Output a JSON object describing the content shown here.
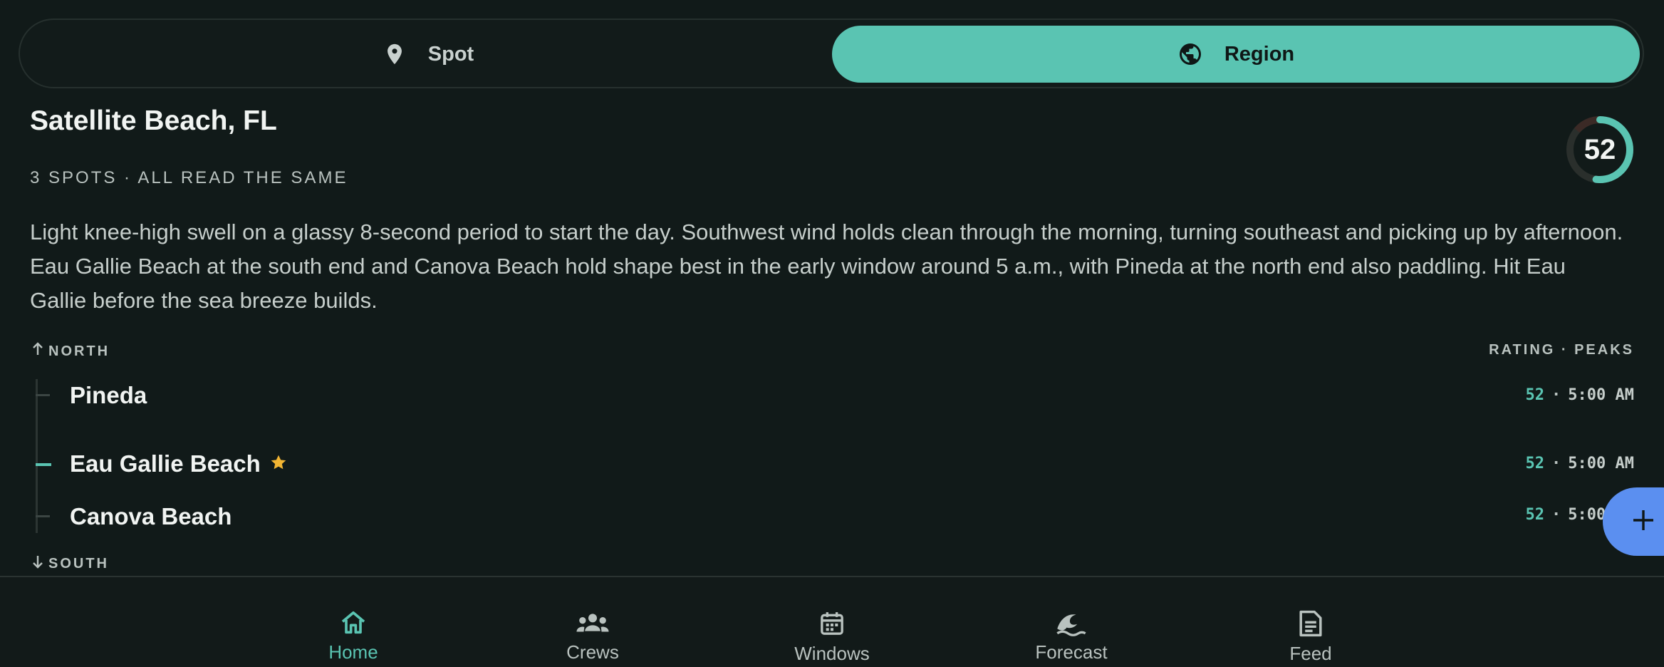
{
  "tabs": {
    "spot_label": "Spot",
    "region_label": "Region",
    "active": "region"
  },
  "region": {
    "title": "Satellite Beach, FL",
    "subtitle": "3 SPOTS · ALL READ THE SAME",
    "score": "52",
    "score_fraction": 0.52,
    "summary": "Light knee-high swell on a glassy 8-second period to start the day. Southwest wind holds clean through the morning, turning southeast and picking up by afternoon. Eau Gallie Beach at the south end and Canova Beach hold shape best in the early window around 5 a.m., with Pineda at the north end also paddling. Hit Eau Gallie before the sea breeze builds."
  },
  "list": {
    "north_label": "NORTH",
    "south_label": "SOUTH",
    "column_header": "RATING · PEAKS",
    "separator": "·",
    "spots": [
      {
        "name": "Pineda",
        "rating": "52",
        "peak": "5:00 AM",
        "favorite": false
      },
      {
        "name": "Eau Gallie Beach",
        "rating": "52",
        "peak": "5:00 AM",
        "favorite": true
      },
      {
        "name": "Canova Beach",
        "rating": "52",
        "peak": "5:00 AM",
        "favorite": false
      }
    ]
  },
  "nav": {
    "items": [
      {
        "label": "Home",
        "icon": "home-icon",
        "active": true
      },
      {
        "label": "Crews",
        "icon": "crews-icon",
        "active": false
      },
      {
        "label": "Windows",
        "icon": "calendar-icon",
        "active": false
      },
      {
        "label": "Forecast",
        "icon": "wave-icon",
        "active": false
      },
      {
        "label": "Feed",
        "icon": "feed-icon",
        "active": false
      }
    ]
  },
  "colors": {
    "background": "#111a19",
    "accent": "#5ac4b2",
    "fab": "#5b8ff0",
    "favorite_star": "#f2b533"
  },
  "fab": {
    "icon": "plus-icon"
  }
}
